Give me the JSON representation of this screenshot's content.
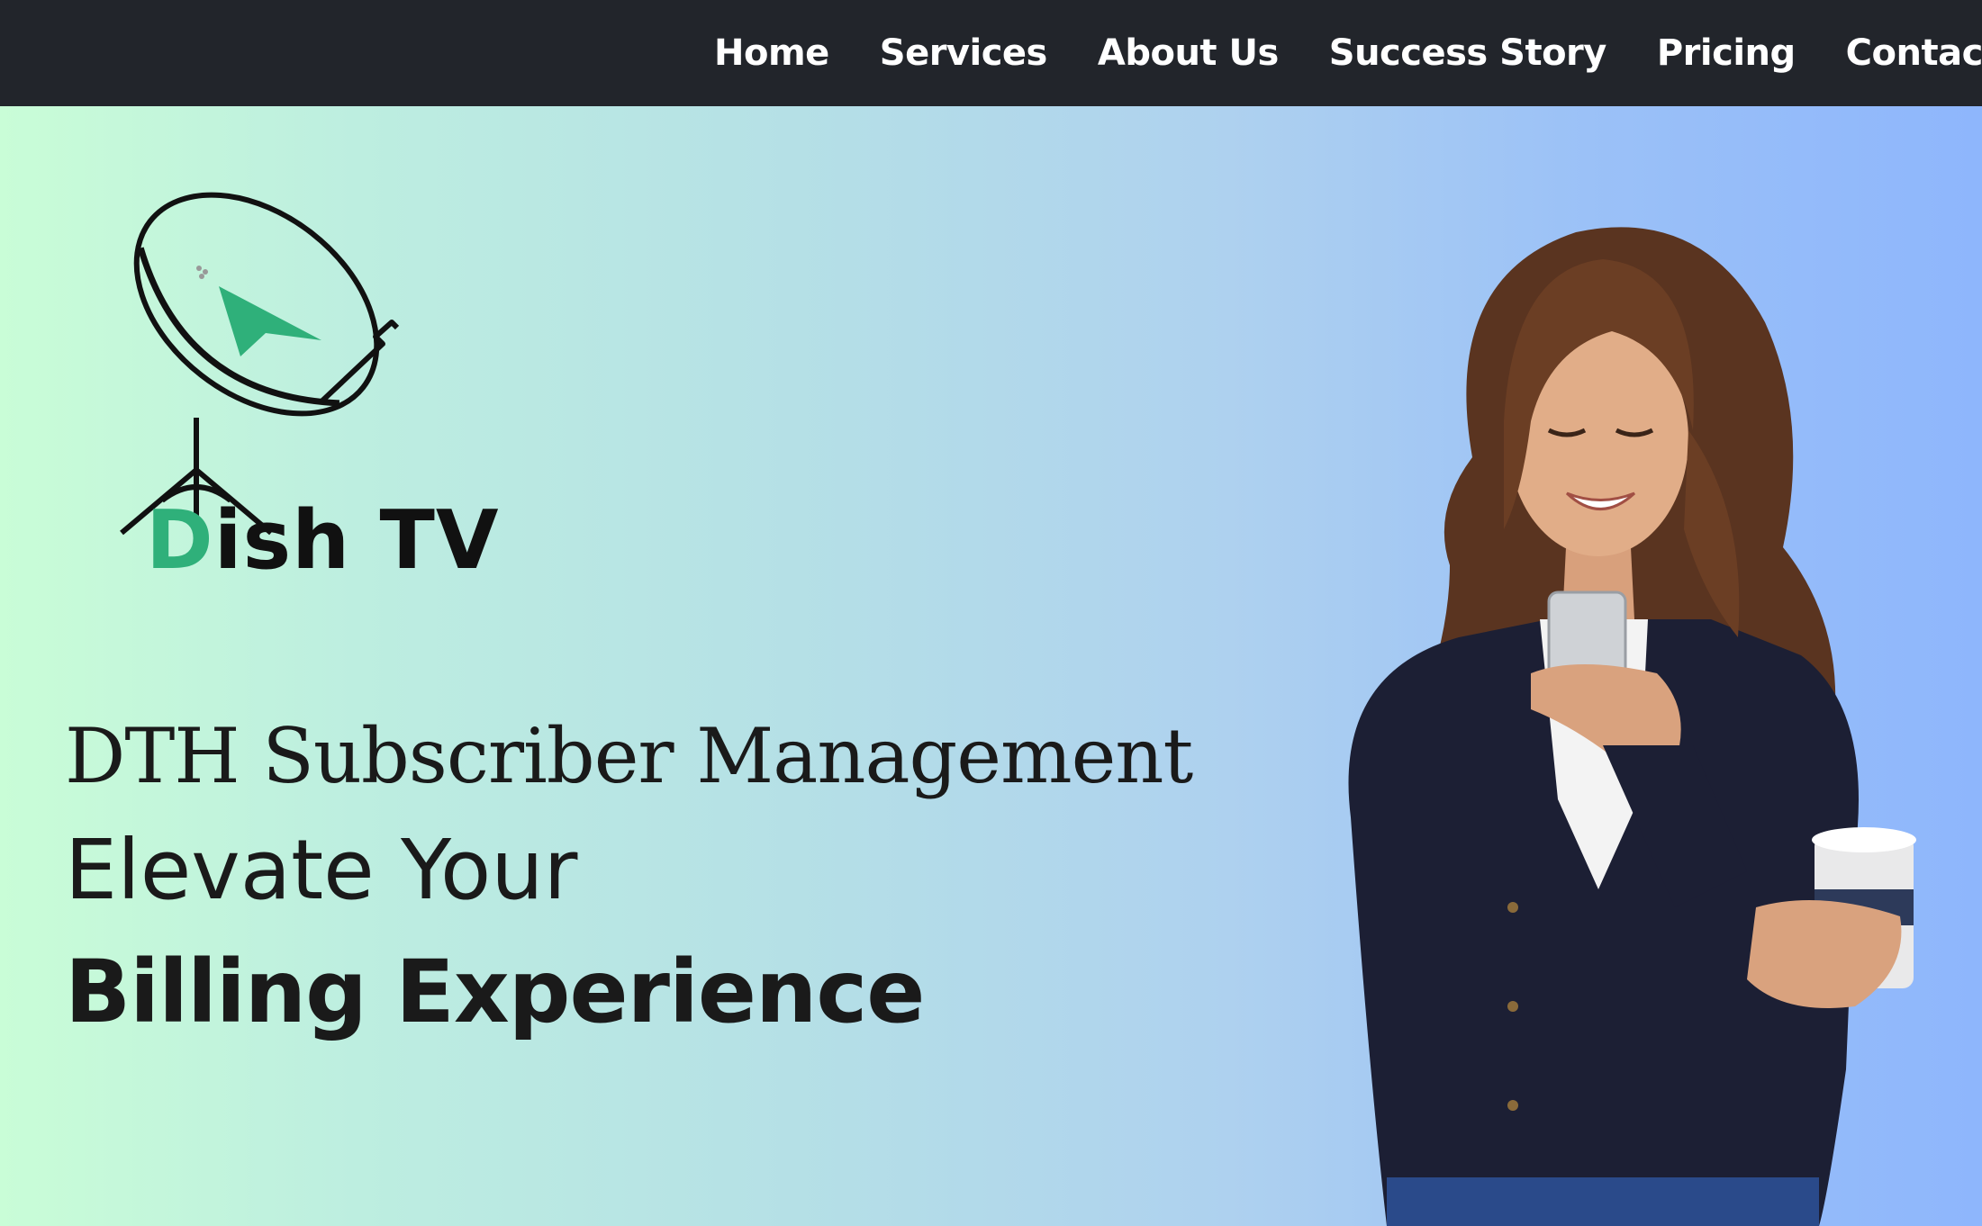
{
  "nav": {
    "items": [
      {
        "label": "Home"
      },
      {
        "label": "Services"
      },
      {
        "label": "About Us"
      },
      {
        "label": "Success Story"
      },
      {
        "label": "Pricing"
      },
      {
        "label": "Contact Us"
      }
    ]
  },
  "logo": {
    "accent_letter": "D",
    "rest": "ish TV",
    "icon": "satellite-dish-icon"
  },
  "hero": {
    "line1": "DTH Subscriber Management",
    "line2": "Elevate Your",
    "line3": "Billing Experience"
  },
  "colors": {
    "nav_bg": "#22252b",
    "accent": "#2fb07a",
    "gradient_start": "#c9fdd7",
    "gradient_end": "#8eb6fc"
  }
}
